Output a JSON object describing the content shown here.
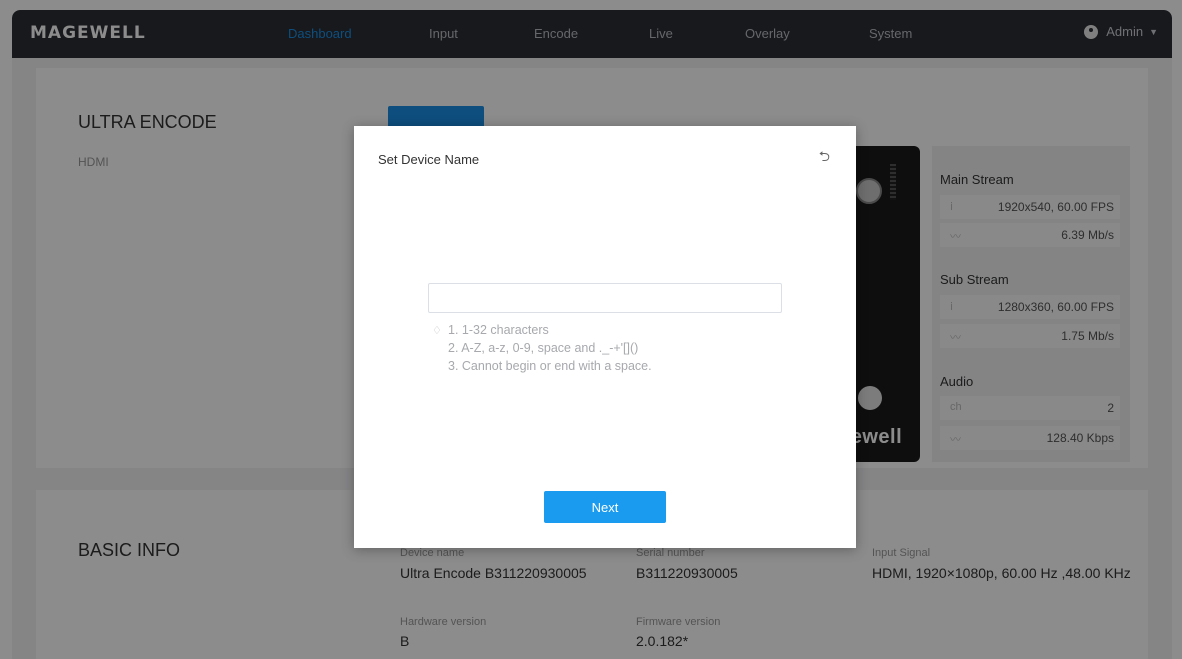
{
  "header": {
    "logo": "MAGEWELL",
    "nav": [
      "Dashboard",
      "Input",
      "Encode",
      "Live",
      "Overlay",
      "System"
    ],
    "active_nav": "Dashboard",
    "user": "Admin"
  },
  "device": {
    "title": "ULTRA ENCODE",
    "subtitle": "HDMI",
    "image_brand": "gewell"
  },
  "stats": {
    "main_title": "Main Stream",
    "main_res": "1920x540, 60.00 FPS",
    "main_bitrate": "6.39 Mb/s",
    "sub_title": "Sub Stream",
    "sub_res": "1280x360, 60.00 FPS",
    "sub_bitrate": "1.75 Mb/s",
    "audio_title": "Audio",
    "audio_ch_label": "ch",
    "audio_ch": "2",
    "audio_bitrate": "128.40 Kbps"
  },
  "basic_info": {
    "title": "BASIC INFO",
    "device_name_label": "Device name",
    "device_name": "Ultra Encode B311220930005",
    "serial_label": "Serial number",
    "serial": "B311220930005",
    "input_signal_label": "Input Signal",
    "input_signal": "HDMI, 1920×1080p, 60.00 Hz ,48.00 KHz",
    "hardware_label": "Hardware version",
    "hardware": "B",
    "firmware_label": "Firmware version",
    "firmware": "2.0.182*"
  },
  "dialog": {
    "title": "Set Device Name",
    "input_value": "",
    "input_placeholder": "",
    "rule1": "1. 1-32 characters",
    "rule2": "2. A-Z, a-z, 0-9, space and ._-+'[]()",
    "rule3": "3. Cannot begin or end with a space.",
    "next_label": "Next"
  },
  "colors": {
    "accent": "#1a8fe6",
    "topbar": "#2c2e33",
    "overlay": "rgba(0,0,0,0.45)"
  }
}
